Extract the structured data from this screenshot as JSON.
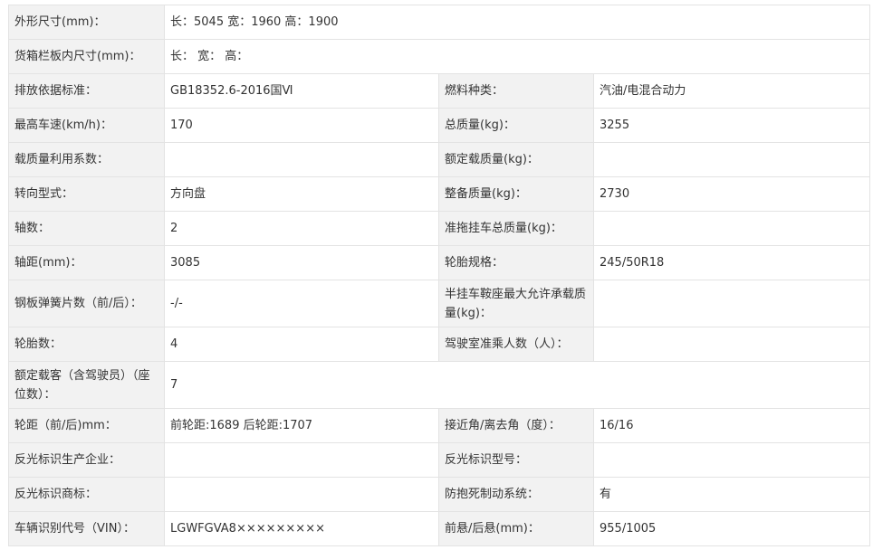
{
  "rows": [
    {
      "type": "span",
      "label": "外形尺寸(mm)：",
      "value": "长：5045 宽：1960 高：1900"
    },
    {
      "type": "span",
      "label": "货箱栏板内尺寸(mm)：",
      "value": "长：  宽：  高："
    },
    {
      "type": "pair",
      "l1": "排放依据标准：",
      "v1": "GB18352.6-2016国Ⅵ",
      "l2": "燃料种类：",
      "v2": "汽油/电混合动力"
    },
    {
      "type": "pair",
      "l1": "最高车速(km/h)：",
      "v1": "170",
      "l2": "总质量(kg)：",
      "v2": "3255"
    },
    {
      "type": "pair",
      "l1": "载质量利用系数：",
      "v1": "",
      "l2": "额定载质量(kg)：",
      "v2": ""
    },
    {
      "type": "pair",
      "l1": "转向型式：",
      "v1": "方向盘",
      "l2": "整备质量(kg)：",
      "v2": "2730"
    },
    {
      "type": "pair",
      "l1": "轴数：",
      "v1": "2",
      "l2": "准拖挂车总质量(kg)：",
      "v2": ""
    },
    {
      "type": "pair",
      "l1": "轴距(mm)：",
      "v1": "3085",
      "l2": "轮胎规格：",
      "v2": "245/50R18"
    },
    {
      "type": "pair",
      "l1": "钢板弹簧片数（前/后）：",
      "v1": "-/-",
      "l2": "半挂车鞍座最大允许承载质量(kg)：",
      "v2": ""
    },
    {
      "type": "pair",
      "l1": "轮胎数：",
      "v1": "4",
      "l2": "驾驶室准乘人数（人）：",
      "v2": ""
    },
    {
      "type": "span",
      "label": "额定载客（含驾驶员）（座位数）：",
      "value": "7"
    },
    {
      "type": "pair",
      "l1": "轮距（前/后)mm：",
      "v1": "前轮距:1689 后轮距:1707",
      "l2": "接近角/离去角（度）：",
      "v2": "16/16"
    },
    {
      "type": "pair",
      "l1": "反光标识生产企业：",
      "v1": "",
      "l2": "反光标识型号：",
      "v2": ""
    },
    {
      "type": "pair",
      "l1": "反光标识商标：",
      "v1": "",
      "l2": "防抱死制动系统：",
      "v2": "有"
    },
    {
      "type": "pair",
      "l1": "车辆识别代号（VIN）：",
      "v1": "LGWFGVA8×××××××××",
      "l2": "前悬/后悬(mm)：",
      "v2": "955/1005"
    }
  ]
}
